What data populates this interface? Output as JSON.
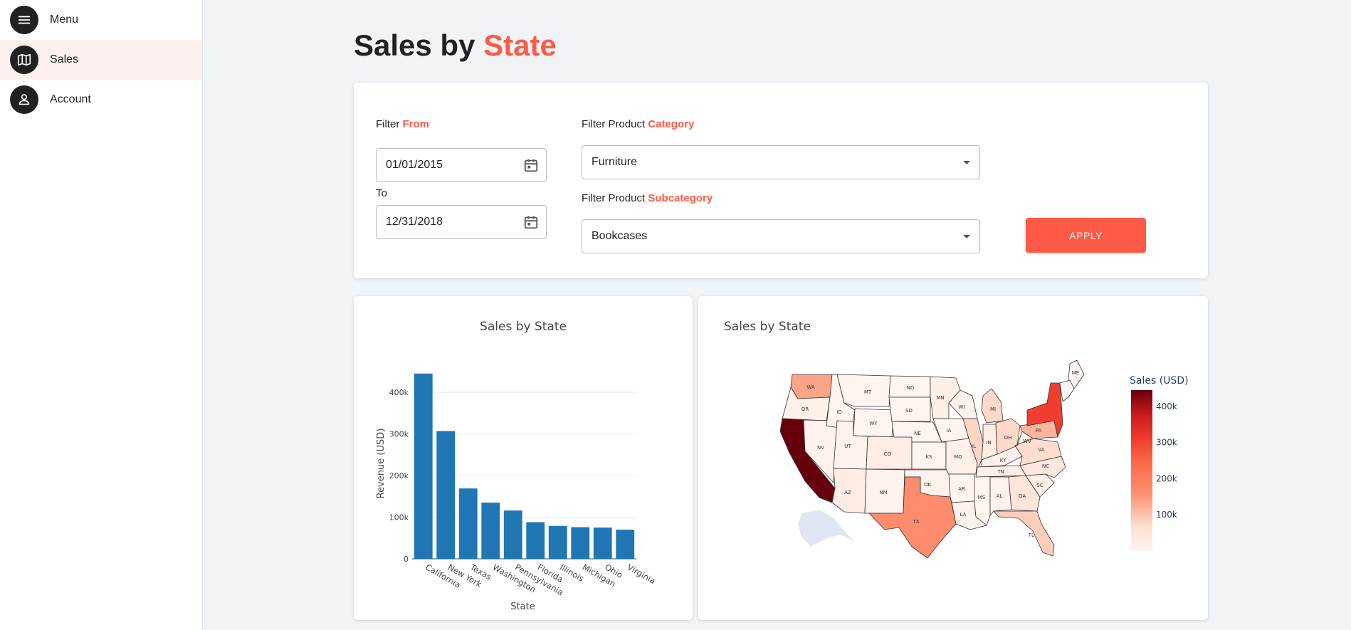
{
  "sidebar": {
    "items": [
      {
        "label": "Menu",
        "icon": "menu-icon"
      },
      {
        "label": "Sales",
        "icon": "map-icon",
        "active": true
      },
      {
        "label": "Account",
        "icon": "account-icon"
      }
    ]
  },
  "header": {
    "title_prefix": "Sales by",
    "title_accent": "State"
  },
  "filters": {
    "from_label": "Filter",
    "from_accent": "From",
    "from_value": "01/01/2015",
    "to_label": "To",
    "to_value": "12/31/2018",
    "category_label": "Filter Product",
    "category_accent": "Category",
    "category_value": "Furniture",
    "subcategory_label": "Filter Product",
    "subcategory_accent": "Subcategory",
    "subcategory_value": "Bookcases",
    "apply_label": "APPLY"
  },
  "colors": {
    "accent": "#ff5a46",
    "bar": "#1f77b4"
  },
  "chart_data": [
    {
      "type": "bar",
      "title": "Sales by State",
      "xlabel": "State",
      "ylabel": "Revenue (USD)",
      "categories": [
        "California",
        "New York",
        "Texas",
        "Washington",
        "Pennsylvania",
        "Florida",
        "Illinois",
        "Michigan",
        "Ohio",
        "Virginia"
      ],
      "values": [
        445000,
        307000,
        169000,
        135000,
        116000,
        88000,
        79000,
        76000,
        75000,
        70000
      ],
      "ylim": [
        0,
        460000
      ],
      "yticks": [
        0,
        100000,
        200000,
        300000,
        400000
      ],
      "ytick_labels": [
        "0",
        "100k",
        "200k",
        "300k",
        "400k"
      ],
      "grid": true
    },
    {
      "type": "choropleth",
      "title": "Sales by State",
      "colorbar_title": "Sales (USD)",
      "colorbar_ticks": [
        "400k",
        "300k",
        "200k",
        "100k"
      ],
      "colorbar_range": [
        0,
        445000
      ],
      "states": [
        {
          "code": "WA",
          "value": 135000
        },
        {
          "code": "OR",
          "value": 17000
        },
        {
          "code": "CA",
          "value": 445000
        },
        {
          "code": "NV",
          "value": 8000
        },
        {
          "code": "ID",
          "value": 3000
        },
        {
          "code": "MT",
          "value": 2000
        },
        {
          "code": "WY",
          "value": 1000
        },
        {
          "code": "UT",
          "value": 12000
        },
        {
          "code": "AZ",
          "value": 30000
        },
        {
          "code": "CO",
          "value": 25000
        },
        {
          "code": "NM",
          "value": 5000
        },
        {
          "code": "ND",
          "value": 1000
        },
        {
          "code": "SD",
          "value": 1000
        },
        {
          "code": "NE",
          "value": 3000
        },
        {
          "code": "KS",
          "value": 3000
        },
        {
          "code": "OK",
          "value": 10000
        },
        {
          "code": "TX",
          "value": 169000
        },
        {
          "code": "MN",
          "value": 20000
        },
        {
          "code": "IA",
          "value": 3000
        },
        {
          "code": "MO",
          "value": 15000
        },
        {
          "code": "AR",
          "value": 6000
        },
        {
          "code": "LA",
          "value": 10000
        },
        {
          "code": "WI",
          "value": 8000
        },
        {
          "code": "IL",
          "value": 79000
        },
        {
          "code": "MS",
          "value": 4000
        },
        {
          "code": "MI",
          "value": 76000
        },
        {
          "code": "IN",
          "value": 30000
        },
        {
          "code": "KY",
          "value": 15000
        },
        {
          "code": "TN",
          "value": 20000
        },
        {
          "code": "AL",
          "value": 12000
        },
        {
          "code": "OH",
          "value": 75000
        },
        {
          "code": "GA",
          "value": 50000
        },
        {
          "code": "FL",
          "value": 88000
        },
        {
          "code": "SC",
          "value": 20000
        },
        {
          "code": "NC",
          "value": 40000
        },
        {
          "code": "VA",
          "value": 70000
        },
        {
          "code": "WV",
          "value": 2000
        },
        {
          "code": "PA",
          "value": 116000
        },
        {
          "code": "NY",
          "value": 307000
        },
        {
          "code": "ME",
          "value": 2000
        }
      ]
    }
  ]
}
